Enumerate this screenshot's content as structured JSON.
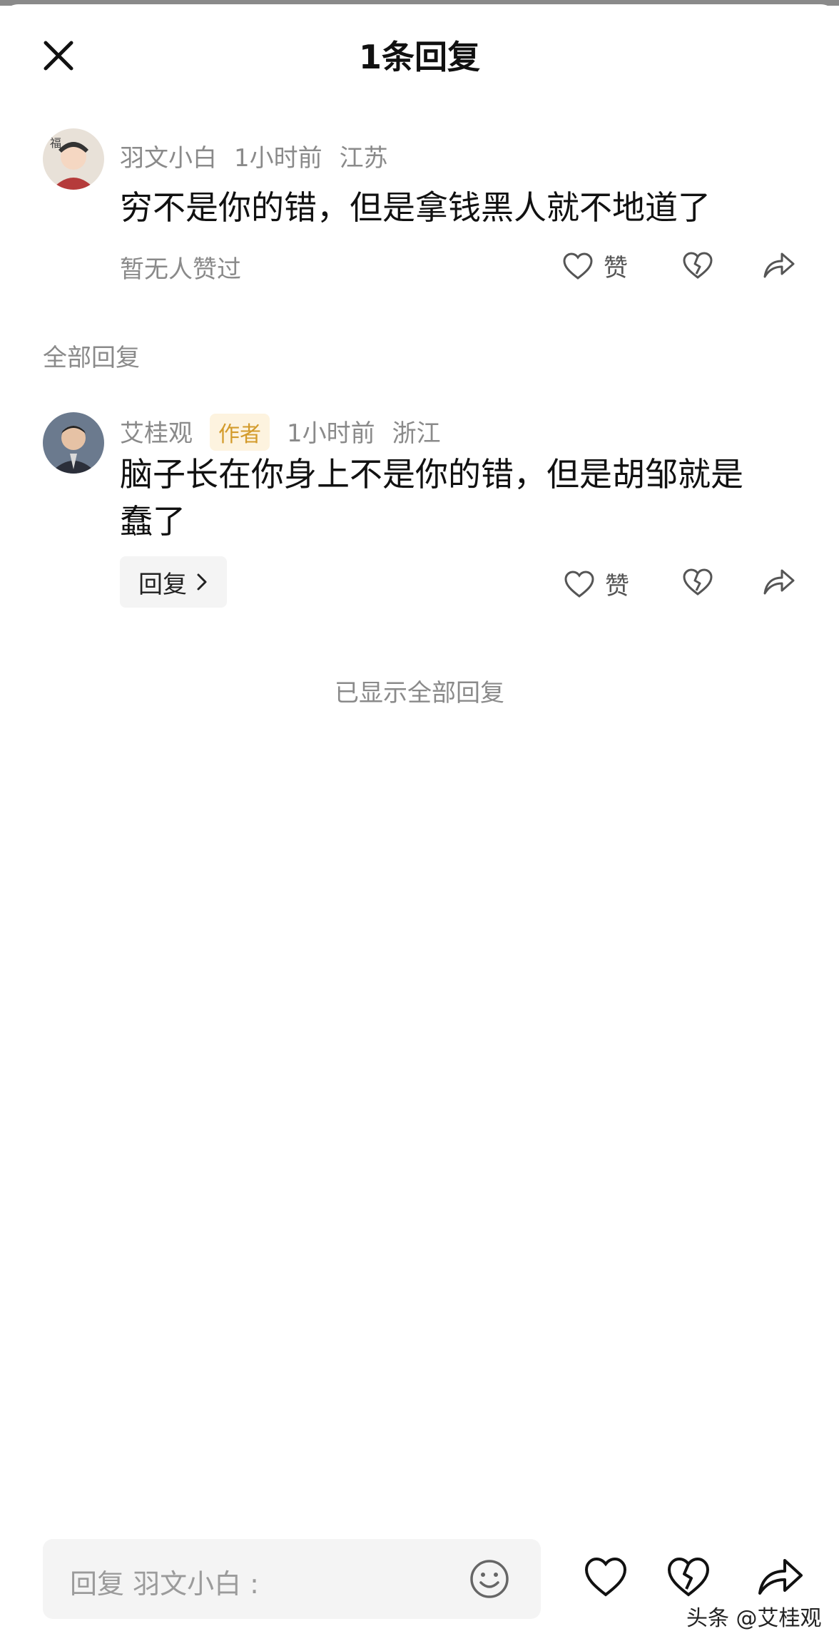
{
  "header": {
    "title": "1条回复"
  },
  "comment": {
    "username": "羽文小白",
    "time": "1小时前",
    "location": "江苏",
    "text": "穷不是你的错，但是拿钱黑人就不地道了",
    "no_likes": "暂无人赞过",
    "like_label": "赞"
  },
  "section_label": "全部回复",
  "reply": {
    "username": "艾桂观",
    "badge": "作者",
    "time": "1小时前",
    "location": "浙江",
    "text_line1": "脑子长在你身上不是你的错，但是胡邹就是",
    "text_line2": "蠢了",
    "reply_button": "回复",
    "like_label": "赞"
  },
  "end_note": "已显示全部回复",
  "composer": {
    "placeholder": "回复 羽文小白 :"
  },
  "watermark": "头条 @艾桂观",
  "icons": [
    "close-icon",
    "heart-icon",
    "broken-heart-icon",
    "share-icon",
    "emoji-icon",
    "chevron-right-icon"
  ]
}
